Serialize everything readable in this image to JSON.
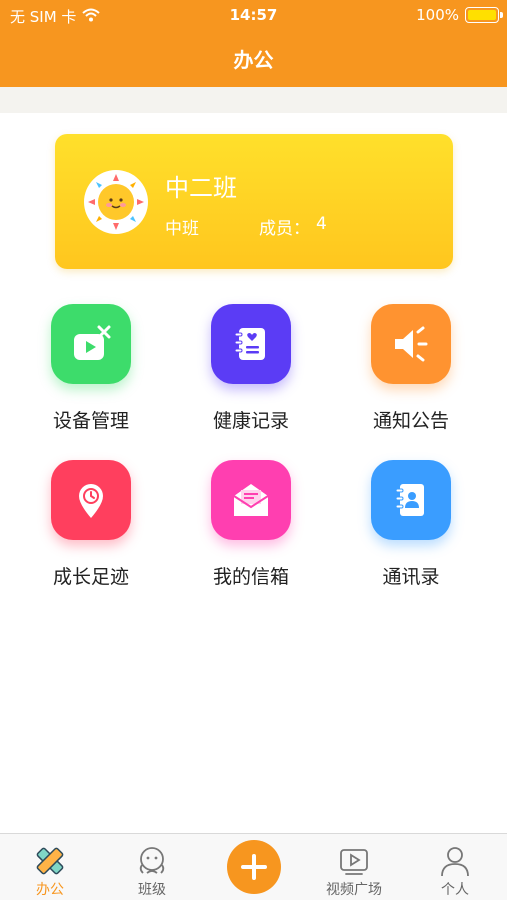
{
  "status_bar": {
    "carrier": "无 SIM 卡",
    "time": "14:57",
    "battery": "100%",
    "battery_level": 1.0
  },
  "nav": {
    "title": "办公"
  },
  "class_card": {
    "name": "中二班",
    "grade": "中班",
    "members_label": "成员：",
    "members_count": "4",
    "avatar_icon": "sun-avatar-icon"
  },
  "features": [
    {
      "label": "设备管理",
      "icon": "device-manage-icon",
      "color": "#3ddc6b"
    },
    {
      "label": "健康记录",
      "icon": "health-notebook-icon",
      "color": "#5b3cf5"
    },
    {
      "label": "通知公告",
      "icon": "speaker-icon",
      "color": "#ff9330"
    },
    {
      "label": "成长足迹",
      "icon": "location-clock-icon",
      "color": "#ff3f5e"
    },
    {
      "label": "我的信箱",
      "icon": "mail-open-icon",
      "color": "#ff3fb0"
    },
    {
      "label": "通讯录",
      "icon": "contact-book-icon",
      "color": "#3a9dff"
    }
  ],
  "tab_bar": {
    "items": [
      {
        "label": "办公",
        "icon": "pencil-ruler-icon",
        "active": true
      },
      {
        "label": "班级",
        "icon": "class-face-icon",
        "active": false
      },
      {
        "label": "",
        "icon": "plus-icon",
        "active": false
      },
      {
        "label": "视频广场",
        "icon": "video-play-icon",
        "active": false
      },
      {
        "label": "个人",
        "icon": "person-icon",
        "active": false
      }
    ]
  },
  "colors": {
    "accent": "#f7961f",
    "card_gradient_top": "#ffe02b",
    "card_gradient_bottom": "#ffc61e"
  }
}
